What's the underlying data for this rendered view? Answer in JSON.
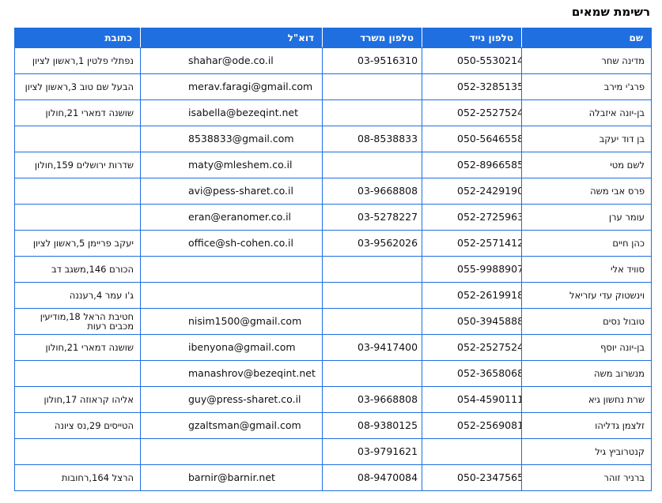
{
  "title": "רשימת שמאים",
  "columns": {
    "name": "שם",
    "mobile": "טלפון נייד",
    "office": "טלפון משרד",
    "email": "דוא\"ל",
    "address": "כתובת"
  },
  "rows": [
    {
      "name": "מדינה שחר",
      "mobile": "050-5530214",
      "office": "03-9516310",
      "email": "shahar@ode.co.il",
      "address": "נפתלי פלטין 1,ראשון לציון"
    },
    {
      "name": "פרג'י מירב",
      "mobile": "052-3285135",
      "office": "",
      "email": "merav.faragi@gmail.com",
      "address": "הבעל שם טוב 3,ראשון לציון"
    },
    {
      "name": "בן-יונה איזבלה",
      "mobile": "052-2527524",
      "office": "",
      "email": "isabella@bezeqint.net",
      "address": "שושנה דמארי 21,חולון"
    },
    {
      "name": "בן דוד יעקב",
      "mobile": "050-5646558",
      "office": "08-8538833",
      "email": "8538833@gmail.com",
      "address": ""
    },
    {
      "name": "לשם מטי",
      "mobile": "052-8966585",
      "office": "",
      "email": "maty@mleshem.co.il",
      "address": "שדרות ירושלים 159,חולון"
    },
    {
      "name": "פרס אבי משה",
      "mobile": "052-2429190",
      "office": "03-9668808",
      "email": "avi@pess-sharet.co.il",
      "address": ""
    },
    {
      "name": "עומר ערן",
      "mobile": "052-2725963",
      "office": "03-5278227",
      "email": "eran@eranomer.co.il",
      "address": ""
    },
    {
      "name": "כהן חיים",
      "mobile": "052-2571412",
      "office": "03-9562026",
      "email": "office@sh-cohen.co.il",
      "address": "יעקב פריימן 5,ראשון לציון"
    },
    {
      "name": "סוויד אלי",
      "mobile": "055-9988907",
      "office": "",
      "email": "",
      "address": "הכורם 146,משגב דב"
    },
    {
      "name": "וינשטוק עדי עזריאל",
      "mobile": "052-2619918",
      "office": "",
      "email": "",
      "address": "ג'ו עמר 4,רעננה"
    },
    {
      "name": "טובול נסים",
      "mobile": "050-3945888",
      "office": "",
      "email": "nisim1500@gmail.com",
      "address": "חטיבת הראל 18,מודיעין מכבים רעות"
    },
    {
      "name": "בן-יונה יוסף",
      "mobile": "052-2527524",
      "office": "03-9417400",
      "email": "ibenyona@gmail.com",
      "address": "שושנה דמארי 21,חולון"
    },
    {
      "name": "מנשרוב משה",
      "mobile": "052-3658068",
      "office": "",
      "email": "manashrov@bezeqint.net",
      "address": ""
    },
    {
      "name": "שרת נחשון גיא",
      "mobile": "054-4590111",
      "office": "03-9668808",
      "email": "guy@press-sharet.co.il",
      "address": "אליהו קראוזה 17,חולון"
    },
    {
      "name": "זלצמן גדליהו",
      "mobile": "052-2569081",
      "office": "08-9380125",
      "email": "gzaltsman@gmail.com",
      "address": "הטייסים 29,נס ציונה"
    },
    {
      "name": "קנטרוביץ גיל",
      "mobile": "",
      "office": "03-9791621",
      "email": "",
      "address": ""
    },
    {
      "name": "ברניר זוהר",
      "mobile": "050-2347565",
      "office": "08-9470084",
      "email": "barnir@barnir.net",
      "address": "הרצל 164,רחובות"
    }
  ]
}
